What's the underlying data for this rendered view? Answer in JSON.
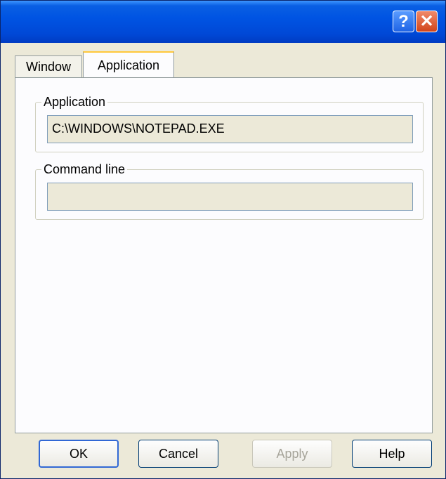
{
  "titlebar": {
    "help_label": "?",
    "close_label": "✕"
  },
  "tabs": [
    {
      "label": "Window",
      "selected": false
    },
    {
      "label": "Application",
      "selected": true
    }
  ],
  "application_group": {
    "legend": "Application",
    "value": "C:\\WINDOWS\\NOTEPAD.EXE"
  },
  "command_group": {
    "legend": "Command line",
    "value": ""
  },
  "buttons": {
    "ok": "OK",
    "cancel": "Cancel",
    "apply": "Apply",
    "help": "Help"
  }
}
